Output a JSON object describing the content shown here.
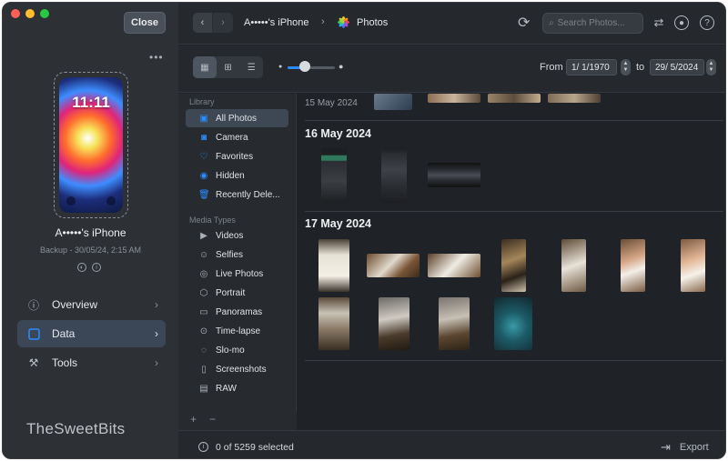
{
  "app": {
    "close_label": "Close",
    "more_label": "•••",
    "brand": "TheSweetBits"
  },
  "device": {
    "name": "A•••••'s iPhone",
    "backup": "Backup - 30/05/24, 2:15 AM",
    "lock_time": "11:11"
  },
  "left_nav": [
    {
      "label": "Overview",
      "icon": "info-icon"
    },
    {
      "label": "Data",
      "icon": "data-icon"
    },
    {
      "label": "Tools",
      "icon": "tools-icon"
    }
  ],
  "header": {
    "back": "‹",
    "forward": "›",
    "device_crumb": "A•••••'s iPhone",
    "separator": "›",
    "section_crumb": "Photos",
    "search_placeholder": "Search Photos..."
  },
  "toolbar": {
    "zoom_level": 0.3,
    "from_label": "From",
    "from_date": "1/  1/1970",
    "to_label": "to",
    "to_date": "29/  5/2024",
    "view_modes": [
      "grid-large-icon",
      "grid-small-icon",
      "list-icon"
    ],
    "selected_view": 0
  },
  "sidebar": {
    "library_title": "Library",
    "library": [
      {
        "label": "All Photos",
        "icon": "photos-icon",
        "selected": true
      },
      {
        "label": "Camera",
        "icon": "camera-icon"
      },
      {
        "label": "Favorites",
        "icon": "heart-icon"
      },
      {
        "label": "Hidden",
        "icon": "eye-icon"
      },
      {
        "label": "Recently Dele...",
        "icon": "trash-icon"
      }
    ],
    "media_title": "Media Types",
    "media": [
      {
        "label": "Videos",
        "icon": "video-icon"
      },
      {
        "label": "Selfies",
        "icon": "selfie-icon"
      },
      {
        "label": "Live Photos",
        "icon": "live-photo-icon"
      },
      {
        "label": "Portrait",
        "icon": "portrait-icon"
      },
      {
        "label": "Panoramas",
        "icon": "panorama-icon"
      },
      {
        "label": "Time-lapse",
        "icon": "timelapse-icon"
      },
      {
        "label": "Slo-mo",
        "icon": "slomo-icon"
      },
      {
        "label": "Screenshots",
        "icon": "screenshot-icon"
      },
      {
        "label": "RAW",
        "icon": "raw-icon"
      }
    ],
    "add_label": "+",
    "remove_label": "−"
  },
  "content": {
    "partial_day": "15 May 2024",
    "days": [
      "16 May 2024",
      "17 May 2024"
    ]
  },
  "status": {
    "selection": "0 of 5259 selected",
    "export_label": "Export"
  },
  "colors": {
    "accent": "#2b8cff",
    "window_bg": "#1f2226",
    "sidebar_bg": "#272b30",
    "left_panel_bg": "#2d3136"
  }
}
